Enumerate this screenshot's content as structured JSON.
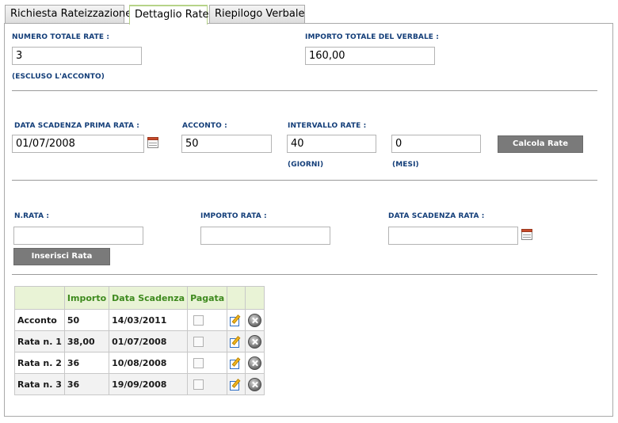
{
  "tabs": [
    {
      "label": "Richiesta Rateizzazione"
    },
    {
      "label": "Dettaglio Rate"
    },
    {
      "label": "Riepilogo Verbale"
    }
  ],
  "section1": {
    "numero_totale_label": "NUMERO TOTALE RATE :",
    "numero_totale_value": "3",
    "escluso_note": "(ESCLUSO L'ACCONTO)",
    "importo_totale_label": "IMPORTO TOTALE DEL VERBALE :",
    "importo_totale_value": "160,00"
  },
  "section2": {
    "data_scadenza_label": "DATA SCADENZA PRIMA RATA :",
    "data_scadenza_value": "01/07/2008",
    "acconto_label": "ACCONTO :",
    "acconto_value": "50",
    "intervallo_label": "INTERVALLO RATE :",
    "intervallo_giorni_value": "40",
    "giorni_note": "(GIORNI)",
    "intervallo_mesi_value": "0",
    "mesi_note": "(MESI)",
    "calcola_button": "Calcola Rate"
  },
  "section3": {
    "nrata_label": "N.RATA :",
    "nrata_value": "",
    "importo_rata_label": "IMPORTO RATA :",
    "importo_rata_value": "",
    "data_scadenza_rata_label": "DATA SCADENZA RATA :",
    "data_scadenza_rata_value": "",
    "inserisci_button": "Inserisci Rata"
  },
  "table": {
    "headers": [
      "",
      "Importo",
      "Data Scadenza",
      "Pagata",
      "",
      ""
    ],
    "rows": [
      {
        "name": "Acconto",
        "importo": "50",
        "data": "14/03/2011"
      },
      {
        "name": "Rata n. 1",
        "importo": "38,00",
        "data": "01/07/2008"
      },
      {
        "name": "Rata n. 2",
        "importo": "36",
        "data": "10/08/2008"
      },
      {
        "name": "Rata n. 3",
        "importo": "36",
        "data": "19/09/2008"
      }
    ]
  },
  "icons": {
    "calendar": "calendar-icon",
    "edit": "edit-icon",
    "delete": "delete-icon"
  }
}
